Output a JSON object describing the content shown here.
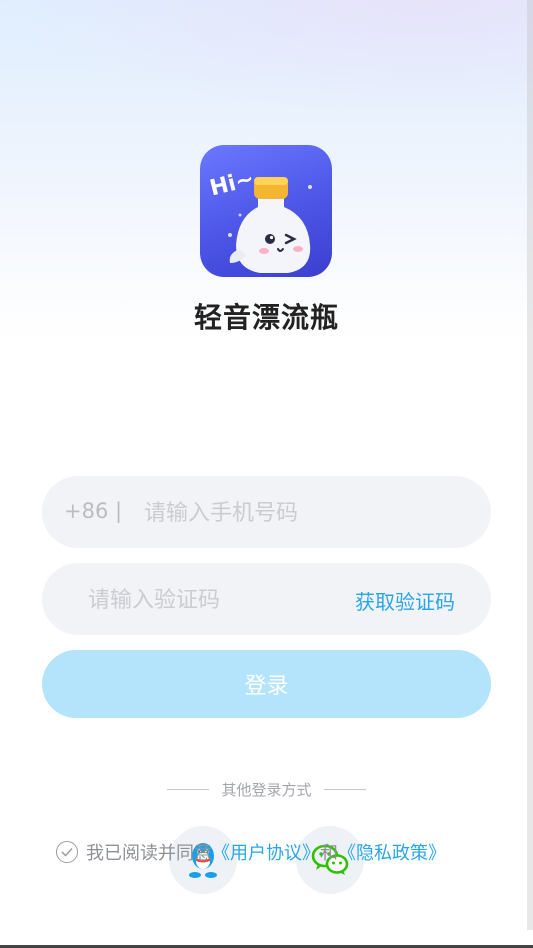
{
  "app": {
    "name": "轻音漂流瓶",
    "icon_text": "Hi~"
  },
  "login_form": {
    "phone_prefix": "+86 |",
    "phone_placeholder": "请输入手机号码",
    "code_placeholder": "请输入验证码",
    "get_code_label": "获取验证码",
    "login_button_label": "登录"
  },
  "other_login": {
    "label": "其他登录方式",
    "options": [
      "qq-icon",
      "wechat-icon"
    ]
  },
  "agreement": {
    "prefix": "我已阅读并同意",
    "user_agreement": "《用户协议》",
    "connector": "和",
    "privacy_policy": "《隐私政策》"
  },
  "colors": {
    "accent": "#2aa6e8",
    "login_button": "#b4e4fb",
    "field_bg": "#f1f3f6",
    "wechat": "#2dc100",
    "qq": "#1a9fe8"
  }
}
